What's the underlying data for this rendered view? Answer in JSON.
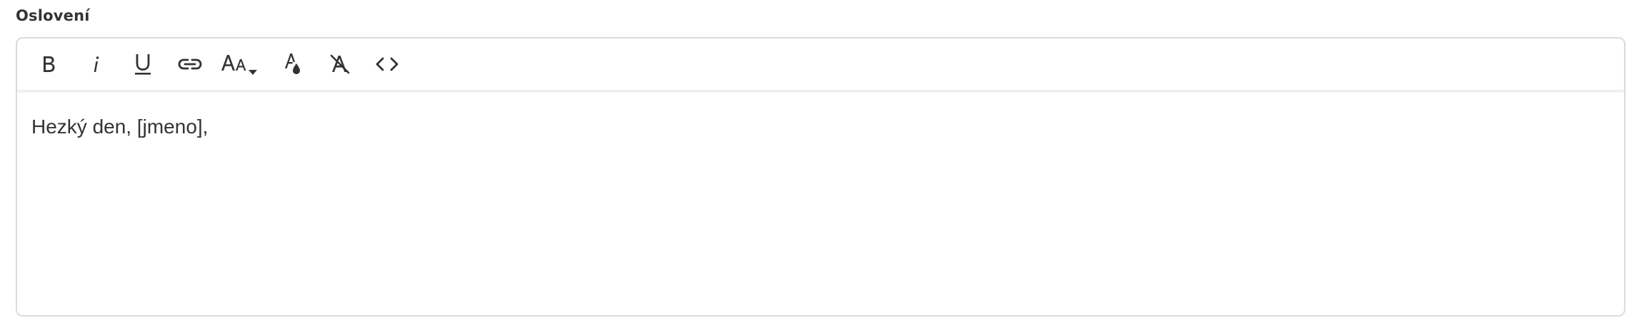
{
  "field": {
    "label": "Oslovení"
  },
  "toolbar": {
    "buttons": [
      {
        "id": "bold",
        "icon": "bold-icon"
      },
      {
        "id": "italic",
        "icon": "italic-icon"
      },
      {
        "id": "underline",
        "icon": "underline-icon"
      },
      {
        "id": "link",
        "icon": "link-icon"
      },
      {
        "id": "font-size",
        "icon": "font-size-icon"
      },
      {
        "id": "text-color",
        "icon": "text-color-icon"
      },
      {
        "id": "clear-formatting",
        "icon": "clear-formatting-icon"
      },
      {
        "id": "code-view",
        "icon": "code-view-icon"
      }
    ]
  },
  "editor": {
    "content": "Hezký den, [jmeno],"
  },
  "colors": {
    "text": "#333333",
    "border": "#dcdcdc"
  }
}
